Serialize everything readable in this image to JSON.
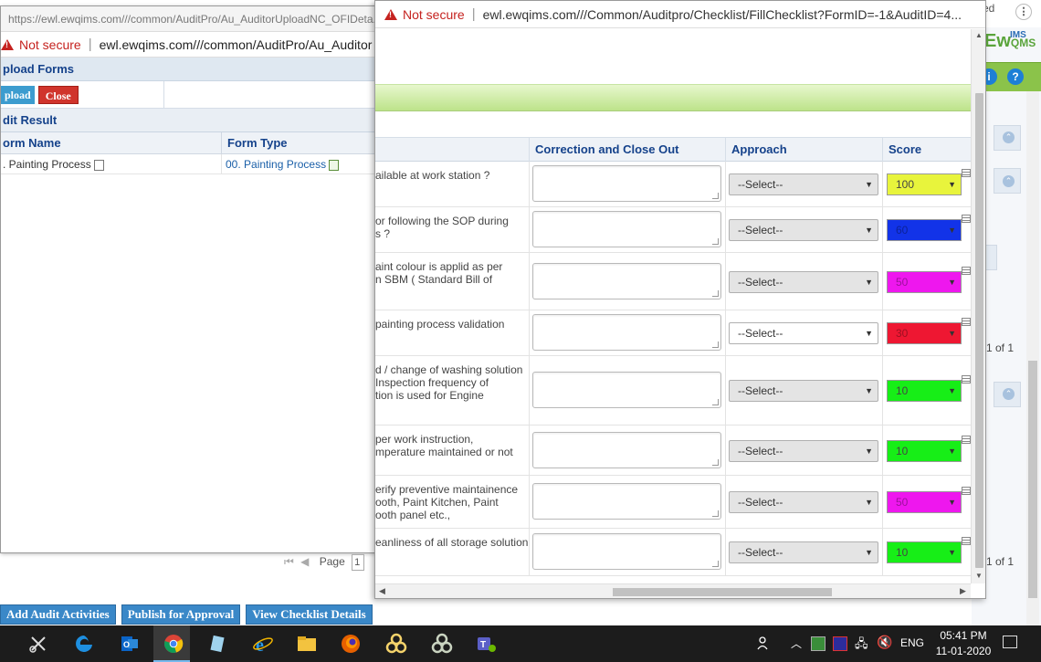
{
  "background_app": {
    "bottom_buttons": [
      "Add Audit Activities",
      "Publish for Approval",
      "View Checklist Details"
    ],
    "logo_text": "Ew",
    "logo_suffix": "QMS",
    "logo_ims": "IMS",
    "info_btn": "i",
    "help_btn": "?",
    "pager_text_1": "1 of 1",
    "pager_text_2": "1 of 1",
    "chrome_menu": "⋮",
    "right_tab_text": "ed"
  },
  "left_window": {
    "title_url": "https://ewl.ewqims.com///common/AuditPro/Au_AuditorUploadNC_OFIDeta...",
    "not_secure": "Not secure",
    "address": "ewl.ewqims.com///common/AuditPro/Au_Auditor",
    "section_title": "pload Forms",
    "upload_button": "pload",
    "close_button": "Close",
    "result_title": "dit Result",
    "grid": {
      "columns": [
        "orm Name",
        "Form Type"
      ],
      "rows": [
        {
          "form_name": ". Painting Process",
          "form_type": "00. Painting Process"
        }
      ]
    },
    "pager": {
      "page_label": "Page",
      "page_value": "1"
    }
  },
  "right_window": {
    "not_secure": "Not secure",
    "address": "ewl.ewqims.com///Common/Auditpro/Checklist/FillChecklist?FormID=-1&AuditID=4...",
    "grid": {
      "columns": [
        "Correction and Close Out",
        "Approach",
        "Score"
      ],
      "rows": [
        {
          "question": "ailable at work station ?",
          "approach": "--Select--",
          "score": "100",
          "score_color": "#e8f43c"
        },
        {
          "question": "or following the SOP during\ns ?",
          "approach": "--Select--",
          "score": "60",
          "score_color": "#1233e8"
        },
        {
          "question": "aint colour is applid as per\nn SBM ( Standard Bill of",
          "approach": "--Select--",
          "score": "50",
          "score_color": "#ee17ee"
        },
        {
          "question": " painting process validation",
          "approach": "--Select--",
          "score": "30",
          "score_color": "#ee1732"
        },
        {
          "question": "d / change of washing solution\n Inspection frequency of\ntion is used for Engine",
          "approach": "--Select--",
          "score": "10",
          "score_color": "#17ee17"
        },
        {
          "question": "per work instruction,\nmperature maintained or not",
          "approach": "--Select--",
          "score": "10",
          "score_color": "#17ee17"
        },
        {
          "question": "erify preventive maintainence\nooth, Paint Kitchen, Paint\nooth panel etc.,",
          "approach": "--Select--",
          "score": "50",
          "score_color": "#ee17ee"
        },
        {
          "question": "eanliness of all storage solution",
          "approach": "--Select--",
          "score": "10",
          "score_color": "#17ee17"
        }
      ]
    }
  },
  "taskbar": {
    "language": "ENG",
    "time": "05:41 PM",
    "date": "11-01-2020",
    "apps": [
      "snipping-tool",
      "edge",
      "outlook",
      "chrome",
      "notepad",
      "internet-explorer",
      "file-explorer",
      "firefox",
      "app-1",
      "app-2",
      "teams"
    ]
  }
}
